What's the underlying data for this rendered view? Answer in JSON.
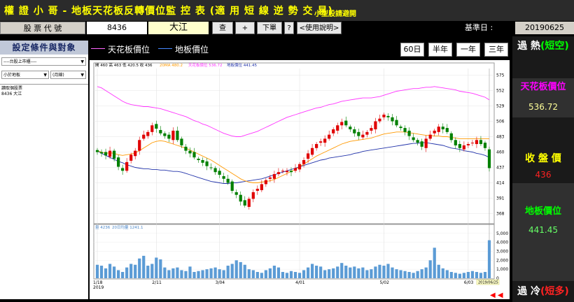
{
  "header": {
    "title": "權 證 小 哥 - 地板天花板反轉價位監 控 表 (適 用 短 線 逆 勢 交 易)",
    "subtitle": "小型股請避開"
  },
  "stock": {
    "code_label": "股 票 代 號",
    "code": "8436",
    "name": "大江",
    "query_btn": "查",
    "plus_btn": "+",
    "next_btn": "下單",
    "help_btn": "?",
    "manual_btn": "<使用說明>",
    "base_date_label": "基準日 :",
    "base_date": "20190625"
  },
  "left_panel": {
    "title": "設定條件與對象",
    "market_select": "----台股上市櫃----",
    "filter_select": "小於地板",
    "period_select": "(月線)",
    "list_header": "讀取個股票",
    "list_items": [
      "8436 大江"
    ]
  },
  "legend": {
    "ceiling": "天花板價位",
    "floor": "地板價位"
  },
  "period_buttons": [
    "60日",
    "半年",
    "一年",
    "三年"
  ],
  "info_line": {
    "ohlc": "開 460  高 463  低 420.5  收 436",
    "ma": "20MA 480.2",
    "ceiling": "天花板價位 536.72",
    "floor": "地板價位 441.45"
  },
  "volume_info": {
    "vol": "量 4236",
    "avg": "20日均量 1241.1"
  },
  "right_panel": {
    "overheat": "過 熱",
    "overheat_sub": "(短空)",
    "ceiling_label": "天花板價位",
    "ceiling_value": "536.72",
    "close_label": "收 盤 價",
    "close_value": "436",
    "floor_label": "地板價位",
    "floor_value": "441.45",
    "overcold": "過 冷",
    "overcold_sub": "(短多)"
  },
  "chart_data": {
    "type": "candlestick",
    "price_ticks": [
      "575",
      "552",
      "529",
      "506",
      "483",
      "460",
      "437",
      "414",
      "391",
      "368"
    ],
    "price_range": [
      357,
      585
    ],
    "volume_ticks": [
      "5,000",
      "4,000",
      "3,000",
      "2,000",
      "1,000",
      "0"
    ],
    "volume_range": [
      0,
      5300
    ],
    "x_ticks": [
      {
        "label": "1/18",
        "sub": "2019",
        "i": 0
      },
      {
        "label": "2/11",
        "i": 14
      },
      {
        "label": "3/04",
        "i": 29
      },
      {
        "label": "4/01",
        "i": 48
      },
      {
        "label": "5/02",
        "i": 68
      },
      {
        "label": "6/03",
        "i": 88
      }
    ],
    "date_marker": "2019/06/25",
    "colors": {
      "up": "#e00000",
      "down": "#008000",
      "ceiling": "#ff33ff",
      "floor": "#2233aa",
      "ma": "#ff9900"
    },
    "close": [
      460,
      458,
      455,
      462,
      450,
      438,
      432,
      445,
      456,
      462,
      478,
      486,
      490,
      500,
      495,
      488,
      484,
      480,
      492,
      478,
      470,
      462,
      458,
      452,
      448,
      444,
      439,
      436,
      430,
      426,
      420,
      414,
      402,
      396,
      386,
      380,
      390,
      400,
      405,
      412,
      418,
      422,
      427,
      430,
      432,
      432,
      430,
      436,
      442,
      448,
      458,
      466,
      472,
      476,
      480,
      486,
      494,
      500,
      505,
      500,
      494,
      488,
      484,
      486,
      490,
      496,
      506,
      510,
      516,
      512,
      506,
      500,
      496,
      490,
      484,
      478,
      474,
      468,
      480,
      486,
      492,
      498,
      494,
      490,
      478,
      470,
      466,
      470,
      472,
      474,
      478,
      472,
      466,
      436
    ],
    "ceiling": [
      558,
      556,
      552,
      548,
      544,
      540,
      536,
      533,
      531,
      530,
      529,
      528,
      528,
      527,
      526,
      525,
      523,
      521,
      519,
      517,
      515,
      513,
      510,
      507,
      505,
      502,
      500,
      497,
      494,
      491,
      488,
      486,
      484,
      483,
      483,
      485,
      487,
      489,
      491,
      494,
      497,
      500,
      503,
      506,
      509,
      512,
      514,
      516,
      518,
      520,
      522,
      524,
      526,
      527,
      529,
      531,
      532,
      534,
      536,
      537,
      538,
      539,
      540,
      541,
      541,
      541,
      542,
      543,
      545,
      547,
      549,
      551,
      552,
      553,
      554,
      555,
      555,
      556,
      557,
      557,
      558,
      557,
      556,
      555,
      554,
      553,
      551,
      550,
      549,
      548,
      546,
      544,
      542,
      538
    ],
    "floor": [
      462,
      458,
      455,
      452,
      449,
      446,
      444,
      441,
      439,
      437,
      436,
      435,
      435,
      434,
      434,
      433,
      433,
      432,
      431,
      431,
      430,
      428,
      426,
      424,
      422,
      420,
      418,
      416,
      415,
      414,
      413,
      413,
      414,
      414,
      415,
      416,
      417,
      418,
      419,
      420,
      422,
      424,
      426,
      428,
      430,
      432,
      434,
      436,
      438,
      440,
      442,
      444,
      446,
      448,
      449,
      451,
      452,
      453,
      454,
      455,
      456,
      458,
      459,
      461,
      462,
      463,
      464,
      465,
      466,
      467,
      468,
      469,
      470,
      471,
      472,
      473,
      473,
      474,
      474,
      473,
      472,
      471,
      470,
      468,
      466,
      465,
      464,
      462,
      461,
      460,
      458,
      457,
      455,
      452
    ],
    "ma": [
      462,
      460,
      458,
      459,
      458,
      456,
      455,
      456,
      457,
      459,
      462,
      466,
      470,
      474,
      476,
      477,
      476,
      474,
      472,
      470,
      468,
      466,
      463,
      460,
      457,
      454,
      451,
      448,
      444,
      440,
      436,
      432,
      428,
      424,
      420,
      417,
      415,
      414,
      414,
      415,
      416,
      417,
      419,
      422,
      425,
      428,
      431,
      434,
      438,
      442,
      446,
      450,
      454,
      457,
      460,
      463,
      466,
      469,
      472,
      474,
      476,
      477,
      478,
      479,
      480,
      481,
      483,
      485,
      487,
      488,
      489,
      490,
      490,
      490,
      489,
      488,
      487,
      486,
      485,
      485,
      484,
      484,
      483,
      483,
      482,
      481,
      480,
      480,
      480,
      480,
      480,
      480,
      480,
      480
    ],
    "volume": [
      1500,
      1400,
      1100,
      1600,
      1300,
      900,
      700,
      1200,
      1600,
      1500,
      2200,
      2500,
      1400,
      1600,
      2300,
      2100,
      1200,
      900,
      1100,
      1200,
      900,
      800,
      1300,
      700,
      800,
      900,
      1000,
      1100,
      1200,
      1000,
      900,
      1400,
      1600,
      2000,
      1800,
      1500,
      1000,
      900,
      700,
      600,
      900,
      1100,
      1400,
      1200,
      700,
      600,
      800,
      700,
      600,
      900,
      1200,
      1600,
      1400,
      1300,
      900,
      1000,
      1100,
      1300,
      1700,
      1400,
      1200,
      1300,
      1100,
      1200,
      900,
      1000,
      1300,
      1500,
      1400,
      1600,
      1200,
      1000,
      900,
      800,
      700,
      600,
      800,
      1000,
      1200,
      2000,
      3400,
      1500,
      1100,
      900,
      700,
      600,
      500,
      600,
      700,
      800,
      700,
      600,
      700,
      4236
    ]
  }
}
